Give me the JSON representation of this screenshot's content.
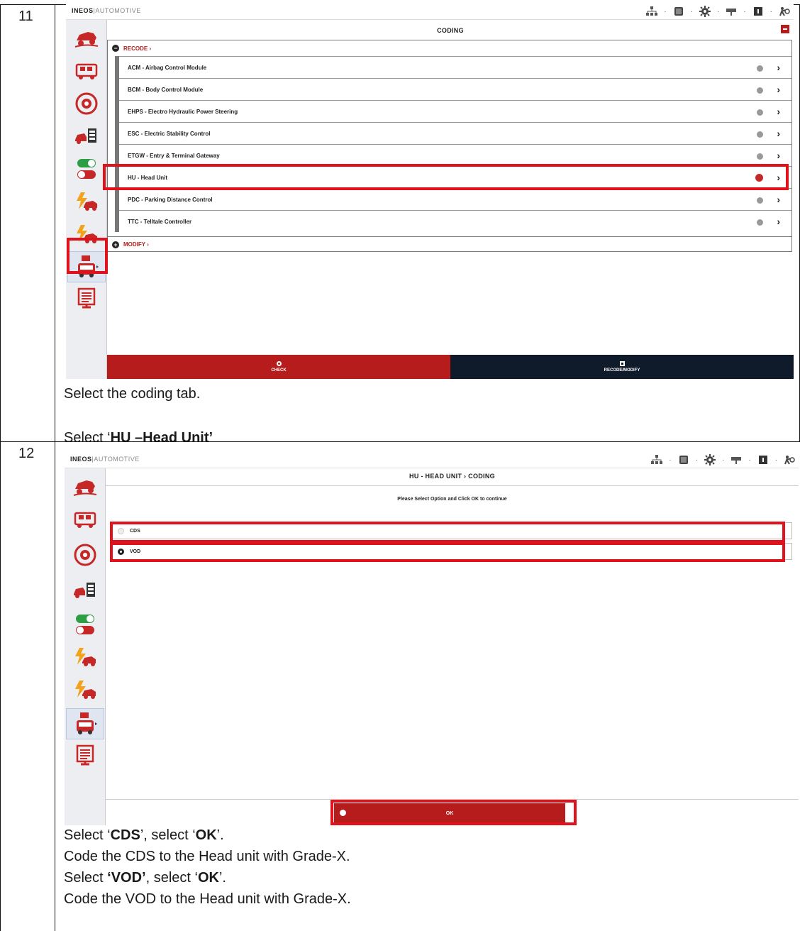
{
  "steps": [
    {
      "number": "11",
      "screen": {
        "brand_primary": "INEOS",
        "brand_secondary": "AUTOMOTIVE",
        "title": "CODING",
        "section_recode": "RECODE ›",
        "section_modify": "MODIFY ›",
        "modules": [
          {
            "label": "ACM - Airbag Control Module",
            "status": "grey"
          },
          {
            "label": "BCM - Body Control Module",
            "status": "grey"
          },
          {
            "label": "EHPS - Electro Hydraulic Power Steering",
            "status": "grey"
          },
          {
            "label": "ESC - Electric Stability Control",
            "status": "grey"
          },
          {
            "label": "ETGW - Entry & Terminal Gateway",
            "status": "grey"
          },
          {
            "label": "HU - Head Unit",
            "status": "error"
          },
          {
            "label": "PDC - Parking Distance Control",
            "status": "grey"
          },
          {
            "label": "TTC - Telltale Controller",
            "status": "grey"
          }
        ],
        "bottom_buttons": {
          "check": "CHECK",
          "recode_modify": "RECODE/MODIFY"
        },
        "colors": {
          "accent_red": "#b71c1c",
          "dark_navy": "#0f1b2b",
          "highlight": "#e0121b"
        }
      },
      "instructions": {
        "line1": "Select the coding tab.",
        "line2_prefix": "Select ‘",
        "line2_bold": "HU –Head Unit’",
        "line2_suffix": ""
      }
    },
    {
      "number": "12",
      "screen": {
        "brand_primary": "INEOS",
        "brand_secondary": "AUTOMOTIVE",
        "title": "HU - HEAD UNIT › CODING",
        "subtitle": "Please Select Option and Click OK to continue",
        "options": [
          {
            "label": "CDS",
            "selected": false
          },
          {
            "label": "VOD",
            "selected": true
          }
        ],
        "ok_label": "OK"
      },
      "instructions": {
        "l1_a": "Select ‘",
        "l1_b": "CDS",
        "l1_c": "’, select ‘",
        "l1_d": "OK",
        "l1_e": "’.",
        "l2": "Code the CDS to the Head unit with Grade-X.",
        "l3_a": "Select ",
        "l3_b": "‘VOD’",
        "l3_c": ", select ‘",
        "l3_d": "OK",
        "l3_e": "’.",
        "l4": "Code the VOD to the Head unit with Grade-X."
      }
    }
  ],
  "icons": {
    "sidebar": [
      "vehicle-offroad-icon",
      "vehicle-diagnostics-icon",
      "dtc-gauge-icon",
      "vehicle-data-icon",
      "toggle-switches-icon",
      "vehicle-power-icon",
      "vehicle-power-2-icon",
      "coding-vehicle-icon",
      "report-icon"
    ],
    "topbar": [
      "network-icon",
      "battery-icon",
      "settings-icon",
      "connection-icon",
      "info-icon",
      "user-icon"
    ]
  }
}
